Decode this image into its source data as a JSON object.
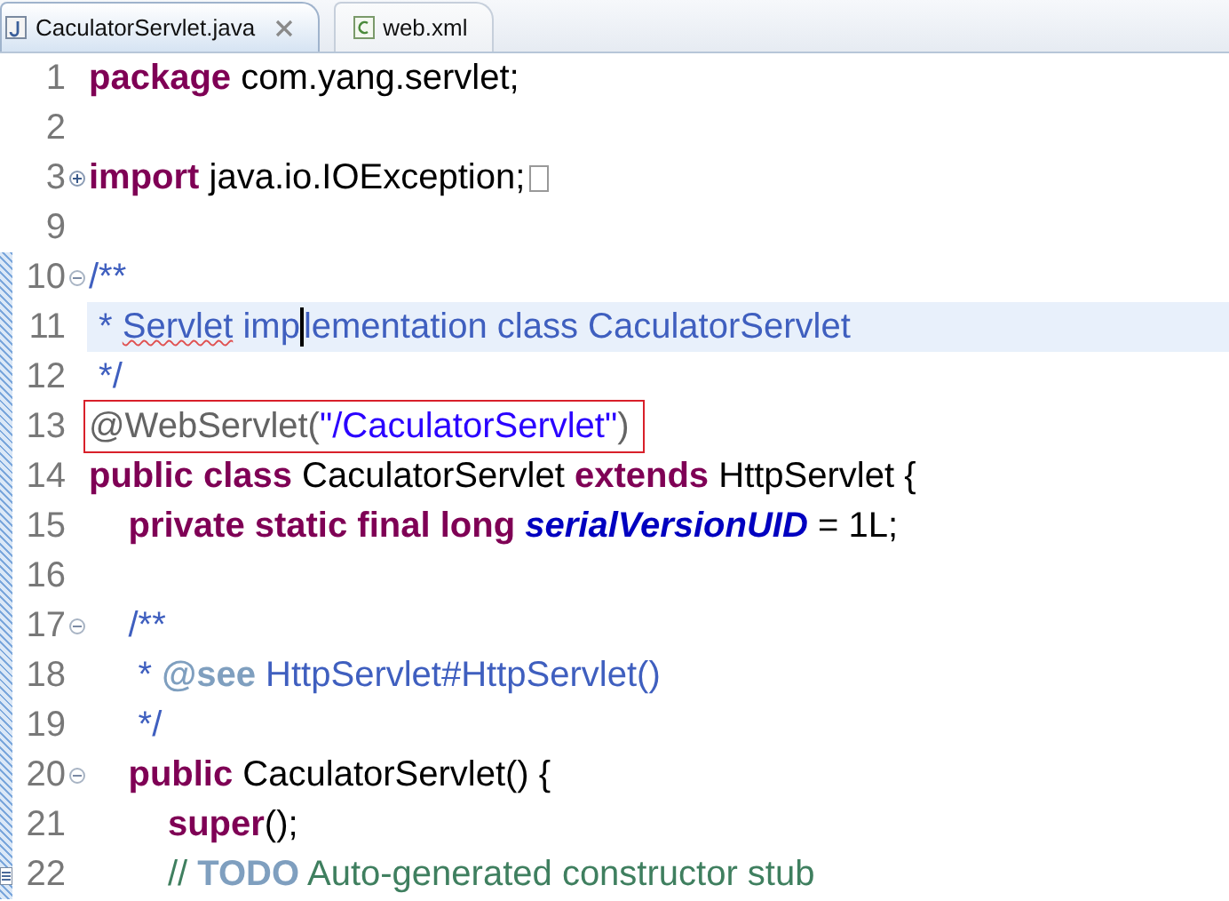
{
  "tabs": [
    {
      "label": "CaculatorServlet.java",
      "kind": "java",
      "selected": true,
      "closable": true
    },
    {
      "label": "web.xml",
      "kind": "xml",
      "selected": false,
      "closable": false
    }
  ],
  "editor": {
    "lines": [
      {
        "number": "1",
        "tokens": [
          {
            "kind": "keyword",
            "text": "package"
          },
          {
            "kind": "plain",
            "text": " com.yang.servlet;"
          }
        ]
      },
      {
        "number": "2"
      },
      {
        "number": "3",
        "collapsed": true,
        "tokens": [
          {
            "kind": "keyword",
            "text": "import"
          },
          {
            "kind": "plain",
            "text": " java.io.IOException;"
          },
          {
            "kind": "folded"
          }
        ]
      },
      {
        "number": "9"
      },
      {
        "number": "10",
        "collapsed": false,
        "tokens": [
          {
            "kind": "doc",
            "text": "/**"
          }
        ]
      },
      {
        "number": "11",
        "current": true,
        "tokens": [
          {
            "kind": "doc",
            "text": " * "
          },
          {
            "kind": "doc-misspelled",
            "text": "Servlet"
          },
          {
            "kind": "doc",
            "text": " imp"
          },
          {
            "kind": "caret"
          },
          {
            "kind": "doc",
            "text": "lementation class CaculatorServlet"
          }
        ]
      },
      {
        "number": "12",
        "tokens": [
          {
            "kind": "doc",
            "text": " */"
          }
        ]
      },
      {
        "number": "13",
        "boxed": true,
        "tokens": [
          {
            "kind": "annotation",
            "text": "@WebServlet("
          },
          {
            "kind": "string",
            "text": "\"/CaculatorServlet\""
          },
          {
            "kind": "annotation",
            "text": ")"
          }
        ]
      },
      {
        "number": "14",
        "tokens": [
          {
            "kind": "keyword",
            "text": "public class"
          },
          {
            "kind": "plain",
            "text": " CaculatorServlet "
          },
          {
            "kind": "keyword",
            "text": "extends"
          },
          {
            "kind": "plain",
            "text": " HttpServlet {"
          }
        ]
      },
      {
        "number": "15",
        "tokens": [
          {
            "kind": "keyword",
            "text": "    private static final long "
          },
          {
            "kind": "field",
            "text": "serialVersionUID"
          },
          {
            "kind": "plain",
            "text": " = 1L;"
          }
        ]
      },
      {
        "number": "16"
      },
      {
        "number": "17",
        "collapsed": false,
        "tokens": [
          {
            "kind": "doc",
            "text": "    /**"
          }
        ]
      },
      {
        "number": "18",
        "tokens": [
          {
            "kind": "doc",
            "text": "     * "
          },
          {
            "kind": "doc-tag",
            "text": "@see"
          },
          {
            "kind": "doc",
            "text": " HttpServlet#HttpServlet()"
          }
        ]
      },
      {
        "number": "19",
        "tokens": [
          {
            "kind": "doc",
            "text": "     */"
          }
        ]
      },
      {
        "number": "20",
        "collapsed": false,
        "tokens": [
          {
            "kind": "keyword",
            "text": "    public"
          },
          {
            "kind": "plain",
            "text": " CaculatorServlet() {"
          }
        ]
      },
      {
        "number": "21",
        "tokens": [
          {
            "kind": "keyword",
            "text": "        super"
          },
          {
            "kind": "plain",
            "text": "();"
          }
        ]
      },
      {
        "number": "22",
        "task_marker": true,
        "tokens": [
          {
            "kind": "comment",
            "text": "        // "
          },
          {
            "kind": "todo",
            "text": "TODO"
          },
          {
            "kind": "comment",
            "text": " Auto-generated constructor stub"
          }
        ]
      }
    ]
  }
}
